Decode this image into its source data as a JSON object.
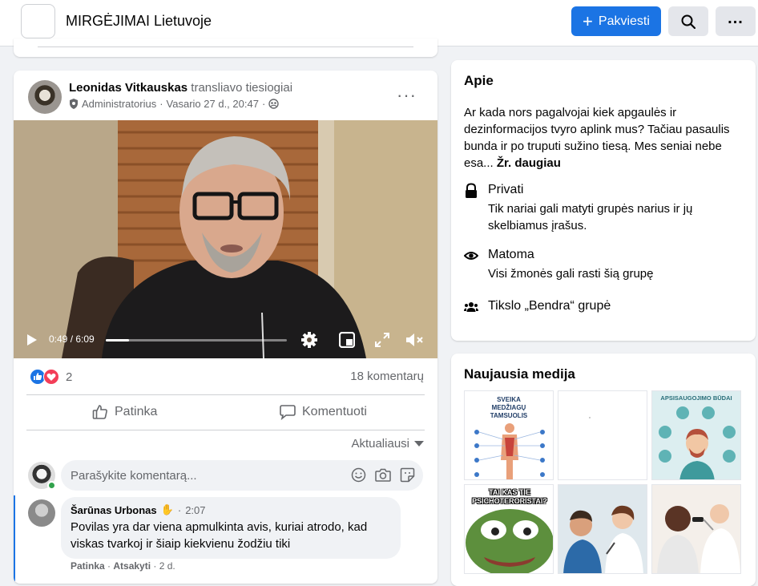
{
  "header": {
    "group_name": "MIRGĖJIMAI Lietuvoje",
    "invite_label": "Pakviesti",
    "search_icon": "search-icon",
    "more_icon": "more-icon"
  },
  "post": {
    "author": "Leonidas Vitkauskas",
    "action": "transliavo tiesiogiai",
    "role": "Administratorius",
    "date": "Vasario 27 d., 20:47",
    "video": {
      "time": "0:49 / 6:09",
      "progress_fraction": 0.13
    },
    "reactions_count": "2",
    "comments_count": "18 komentarų",
    "like_label": "Patinka",
    "comment_label": "Komentuoti",
    "sort_label": "Aktualiausi",
    "comment_placeholder": "Parašykite komentarą...",
    "comment": {
      "name": "Šarūnas Urbonas",
      "time": "2:07",
      "text": "Povilas yra dar viena apmulkinta avis, kuriai atrodo, kad viskas tvarkoj ir šiaip kiekvienu žodžiu tiki",
      "like": "Patinka",
      "reply": "Atsakyti",
      "age": "2 d."
    }
  },
  "about": {
    "title": "Apie",
    "description": "Ar kada nors pagalvojai kiek apgaulės ir dezinformacijos tvyro aplink mus? Tačiau pasaulis bunda ir po truputi sužino tiesą. Mes seniai nebe esa...",
    "see_more": "Žr. daugiau",
    "privacy_title": "Privati",
    "privacy_desc": "Tik nariai gali matyti grupės narius ir jų skelbiamus įrašus.",
    "visibility_title": "Matoma",
    "visibility_desc": "Visi žmonės gali rasti šią grupę",
    "type_label": "Tikslo „Bendra“ grupė"
  },
  "media": {
    "title": "Naujausia medija",
    "tile1_title": "SVEIKA MEDŽIAGŲ TAMSUOLIS",
    "tile3_title": "APSISAUGOJIMO BŪDAI",
    "tile4_caption": "TAI KAS TIE PSICHOTERORISTAI?"
  },
  "colors": {
    "accent": "#1b74e4",
    "background": "#f0f2f5",
    "secondary_text": "#65676b"
  }
}
